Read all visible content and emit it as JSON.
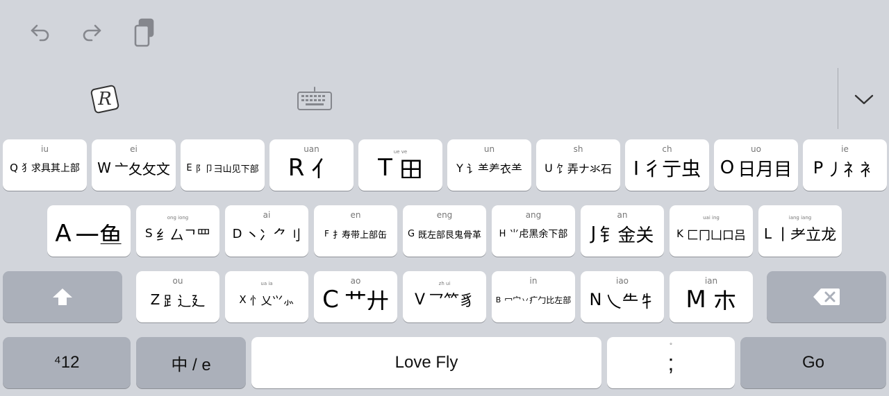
{
  "toolbar": {
    "undo_icon": "undo-icon",
    "redo_icon": "redo-icon",
    "clipboard_icon": "clipboard-icon",
    "app_logo_letter": "R",
    "keyboard_icon": "keyboard-icon",
    "dismiss_icon": "chevron-down-icon"
  },
  "rows": [
    [
      {
        "id": "q",
        "hint": "iu",
        "letter": "Q",
        "glyphs": "犭求具其上部"
      },
      {
        "id": "w",
        "hint": "ei",
        "letter": "W",
        "glyphs": "亠夂攵文"
      },
      {
        "id": "e",
        "hint": "",
        "letter": "E",
        "glyphs": "阝卩彐山见下部"
      },
      {
        "id": "r",
        "hint": "uan",
        "letter": "R",
        "glyphs": "亻"
      },
      {
        "id": "t",
        "hint": "ue ve",
        "letter": "T",
        "glyphs": "田"
      },
      {
        "id": "y",
        "hint": "un",
        "letter": "Y",
        "glyphs": "讠⺷⺶⾐⺷"
      },
      {
        "id": "u",
        "hint": "sh",
        "letter": "U",
        "glyphs": "饣弄ナ氺石"
      },
      {
        "id": "i",
        "hint": "ch",
        "letter": "I",
        "glyphs": "彳亍虫"
      },
      {
        "id": "o",
        "hint": "uo",
        "letter": "O",
        "glyphs": "日月目"
      },
      {
        "id": "p",
        "hint": "ie",
        "letter": "P",
        "glyphs": "丿礻衤"
      }
    ],
    [
      {
        "id": "a",
        "hint": "",
        "letter": "A",
        "glyphs": "一鱼"
      },
      {
        "id": "s",
        "hint": "ong iong",
        "letter": "S",
        "glyphs": "纟厶ᄀ罒"
      },
      {
        "id": "d",
        "hint": "ai",
        "letter": "D",
        "glyphs": "丶冫⺈刂"
      },
      {
        "id": "f",
        "hint": "en",
        "letter": "F",
        "glyphs": "扌寿带上部缶"
      },
      {
        "id": "g",
        "hint": "eng",
        "letter": "G",
        "glyphs": "既左部艮鬼骨革"
      },
      {
        "id": "h",
        "hint": "ang",
        "letter": "H",
        "glyphs": "⺌虍黑余下部"
      },
      {
        "id": "j",
        "hint": "an",
        "letter": "J",
        "glyphs": "钅金关"
      },
      {
        "id": "k",
        "hint": "uai ing",
        "letter": "K",
        "glyphs": "匚冂凵口吕"
      },
      {
        "id": "l",
        "hint": "iang iang",
        "letter": "L",
        "glyphs": "丨耂立龙"
      }
    ],
    [
      {
        "id": "z",
        "hint": "ou",
        "letter": "Z",
        "glyphs": "⻊辶廴"
      },
      {
        "id": "x",
        "hint": "ua ia",
        "letter": "X",
        "glyphs": "忄乂⺍⺗"
      },
      {
        "id": "c",
        "hint": "ao",
        "letter": "C",
        "glyphs": "艹廾"
      },
      {
        "id": "v",
        "hint": "zh ui",
        "letter": "V",
        "glyphs": "乛⺮豸"
      },
      {
        "id": "b",
        "hint": "in",
        "letter": "B",
        "glyphs": "冖宀丷疒勹比左部"
      },
      {
        "id": "n",
        "hint": "iao",
        "letter": "N",
        "glyphs": "乀⺧牜"
      },
      {
        "id": "m",
        "hint": "ian",
        "letter": "M",
        "glyphs": "朩"
      }
    ]
  ],
  "bottom": {
    "numbers_label": "⁴12",
    "lang_label": "中 / e",
    "space_label": "Love Fly",
    "punct_hint": "°",
    "punct_label": ";",
    "go_label": "Go"
  }
}
